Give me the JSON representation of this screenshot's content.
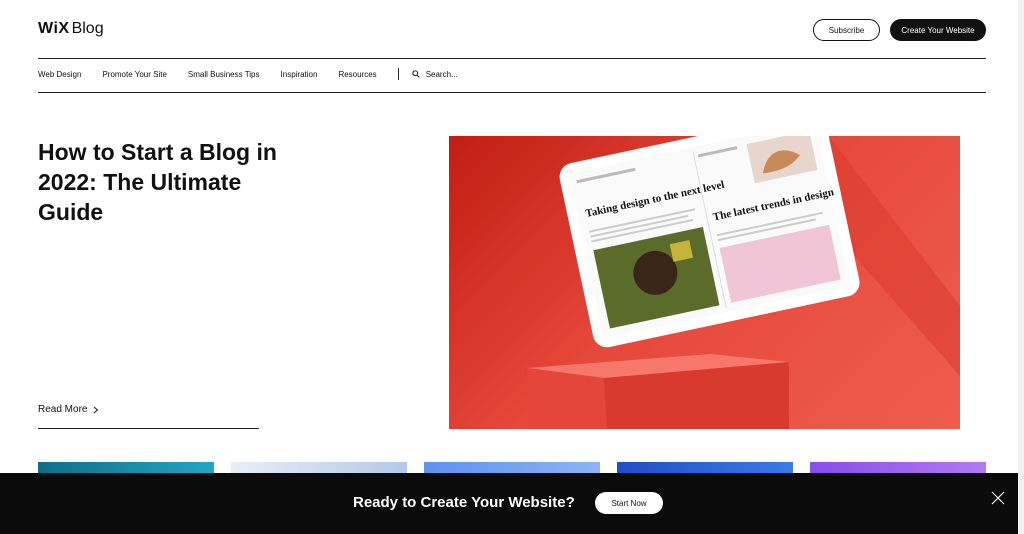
{
  "header": {
    "logo_brand": "WiX",
    "logo_product": "Blog",
    "subscribe_label": "Subscribe",
    "create_label": "Create Your Website"
  },
  "nav": {
    "items": [
      "Web Design",
      "Promote Your Site",
      "Small Business Tips",
      "Inspiration",
      "Resources"
    ],
    "search_placeholder": "Search..."
  },
  "hero": {
    "title": "How to Start a Blog in 2022: The Ultimate Guide",
    "read_more": "Read More",
    "tablet_left_heading": "Taking design to the next level",
    "tablet_right_heading": "The latest trends in design"
  },
  "banner": {
    "text": "Ready to Create Your Website?",
    "button_label": "Start Now"
  },
  "colors": {
    "hero_red": "#e6483a",
    "banner_bg": "#0b0b0b",
    "card_1": "#1a8aa6",
    "card_2": "#c9daf0",
    "card_3": "#6fa0f2",
    "card_4": "#2f66d6",
    "card_5": "#9d62ee"
  },
  "icons": [
    "search-icon",
    "chevron-right-icon",
    "close-icon"
  ]
}
